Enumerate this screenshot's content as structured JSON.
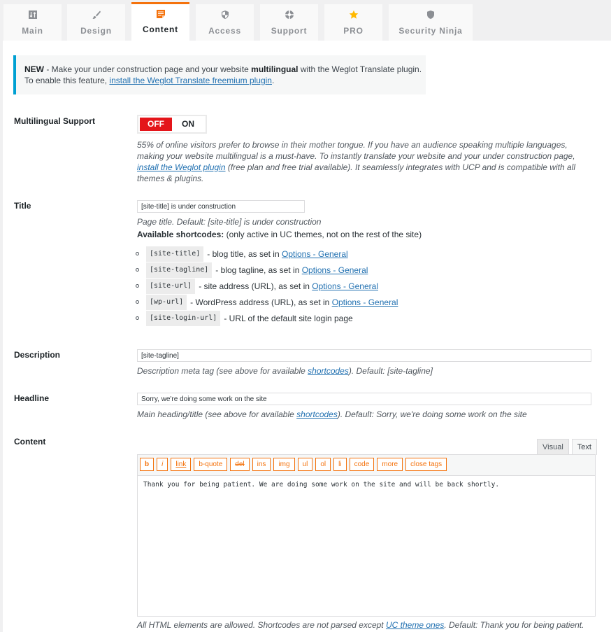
{
  "tabs": [
    {
      "label": "Main",
      "icon": "sliders-icon",
      "active": false
    },
    {
      "label": "Design",
      "icon": "paintbrush-icon",
      "active": false
    },
    {
      "label": "Content",
      "icon": "document-icon",
      "active": true
    },
    {
      "label": "Access",
      "icon": "shield-icon",
      "active": false
    },
    {
      "label": "Support",
      "icon": "lifebuoy-icon",
      "active": false
    },
    {
      "label": "PRO",
      "icon": "star-icon",
      "active": false
    },
    {
      "label": "Security Ninja",
      "icon": "shield-solid-icon",
      "active": false
    }
  ],
  "colors": {
    "accent": "#f4720c",
    "toggle_off": "#e4151a",
    "notice_border": "#00a0d2",
    "link": "#2271b1",
    "pro_star": "#ffb900"
  },
  "notice": {
    "new_label": "NEW",
    "text_1": " - Make your under construction page and your website ",
    "bold_word": "multilingual",
    "text_2": " with the Weglot Translate plugin.",
    "line2_prefix": "To enable this feature, ",
    "link_text": "install the Weglot Translate freemium plugin",
    "line2_suffix": "."
  },
  "multilingual": {
    "label": "Multilingual Support",
    "toggle_off": "OFF",
    "toggle_on": "ON",
    "state": "OFF",
    "desc_1": "55% of online visitors prefer to browse in their mother tongue. If you have an audience speaking multiple languages, making your website multilingual is a must-have. To instantly translate your website and your under construction page, ",
    "desc_link": "install the Weglot plugin",
    "desc_2": " (free plan and free trial available). It seamlessly integrates with UCP and is compatible with all themes & plugins."
  },
  "title": {
    "label": "Title",
    "value": "[site-title] is under construction",
    "desc": "Page title. Default: [site-title] is under construction",
    "shortcodes_label": "Available shortcodes:",
    "shortcodes_note": " (only active in UC themes, not on the rest of the site)",
    "shortcodes": [
      {
        "code": "[site-title]",
        "text": "- blog title, as set in ",
        "link": "Options - General"
      },
      {
        "code": "[site-tagline]",
        "text": "- blog tagline, as set in ",
        "link": "Options - General"
      },
      {
        "code": "[site-url]",
        "text": "- site address (URL), as set in ",
        "link": "Options - General"
      },
      {
        "code": "[wp-url]",
        "text": "- WordPress address (URL), as set in ",
        "link": "Options - General"
      },
      {
        "code": "[site-login-url]",
        "text": "- URL of the default site login page",
        "link": null
      }
    ]
  },
  "description": {
    "label": "Description",
    "value": "[site-tagline]",
    "desc_1": "Description meta tag (see above for available ",
    "desc_link": "shortcodes",
    "desc_2": "). Default: [site-tagline]"
  },
  "headline": {
    "label": "Headline",
    "value": "Sorry, we're doing some work on the site",
    "desc_1": "Main heading/title (see above for available ",
    "desc_link": "shortcodes",
    "desc_2": "). Default: Sorry, we're doing some work on the site"
  },
  "content": {
    "label": "Content",
    "editor_tabs": {
      "visual": "Visual",
      "text": "Text",
      "active": "Text"
    },
    "toolbar": [
      "b",
      "i",
      "link",
      "b-quote",
      "del",
      "ins",
      "img",
      "ul",
      "ol",
      "li",
      "code",
      "more",
      "close tags"
    ],
    "value": "Thank you for being patient. We are doing some work on the site and will be back shortly.",
    "desc_1": "All HTML elements are allowed. Shortcodes are not parsed except ",
    "desc_link": "UC theme ones",
    "desc_2": ". Default: Thank you for being patient."
  }
}
